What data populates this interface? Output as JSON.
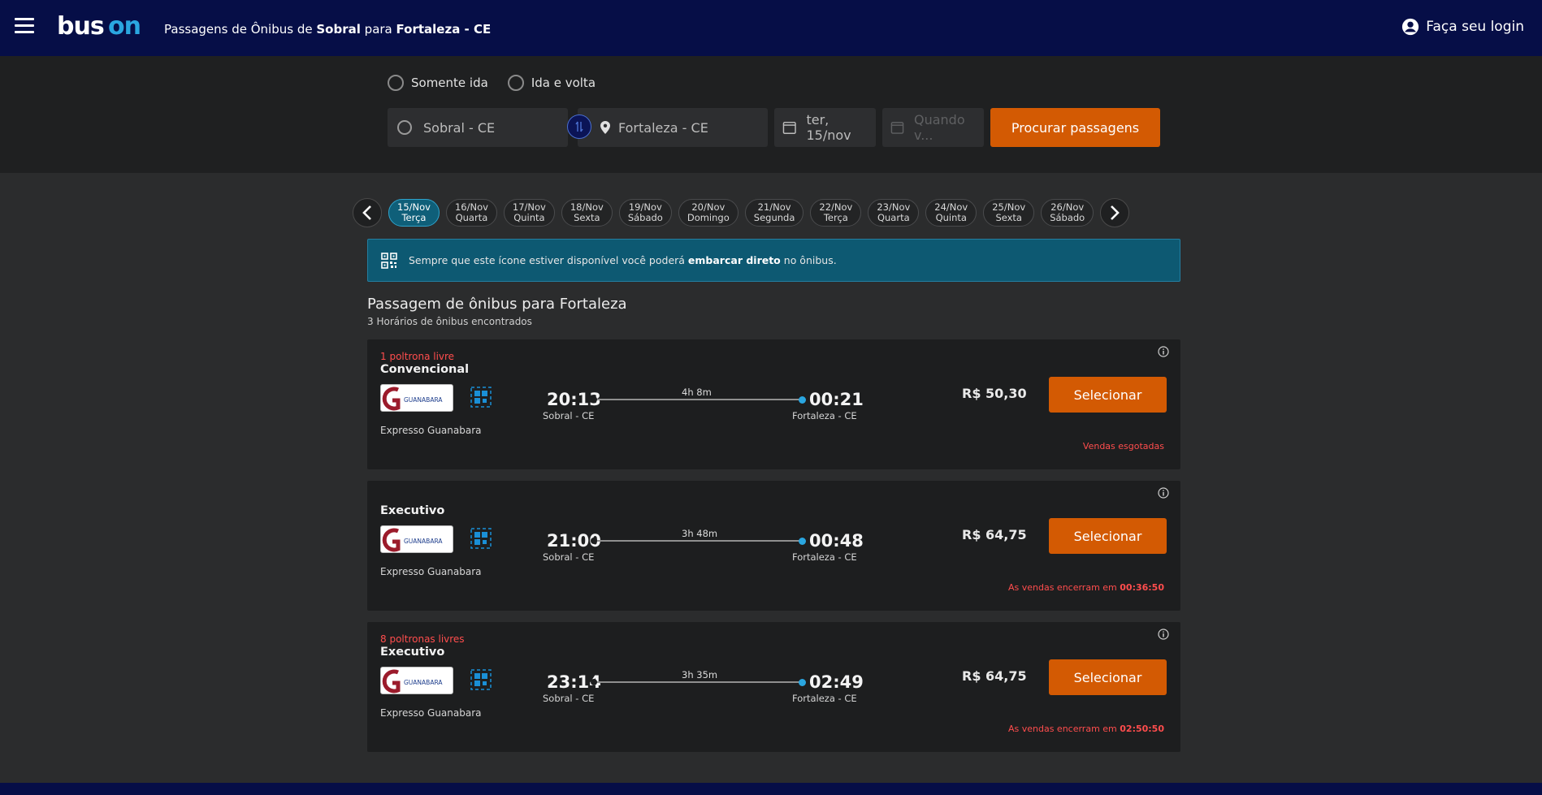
{
  "header": {
    "title_prefix": "Passagens de Ônibus de",
    "origin": "Sobral",
    "title_mid": "para",
    "destination": "Fortaleza - CE",
    "login_label": "Faça seu login",
    "logo_text": "buson"
  },
  "search": {
    "trip_one_way": "Somente ida",
    "trip_round": "Ida e volta",
    "origin_value": "Sobral - CE",
    "destination_value": "Fortaleza - CE",
    "departure_date": "ter, 15/nov",
    "return_placeholder": "Quando v...",
    "search_button": "Procurar passagens"
  },
  "dates": [
    {
      "date": "15/Nov",
      "day": "Terça",
      "active": true
    },
    {
      "date": "16/Nov",
      "day": "Quarta"
    },
    {
      "date": "17/Nov",
      "day": "Quinta"
    },
    {
      "date": "18/Nov",
      "day": "Sexta"
    },
    {
      "date": "19/Nov",
      "day": "Sábado"
    },
    {
      "date": "20/Nov",
      "day": "Domingo"
    },
    {
      "date": "21/Nov",
      "day": "Segunda"
    },
    {
      "date": "22/Nov",
      "day": "Terça"
    },
    {
      "date": "23/Nov",
      "day": "Quarta"
    },
    {
      "date": "24/Nov",
      "day": "Quinta"
    },
    {
      "date": "25/Nov",
      "day": "Sexta"
    },
    {
      "date": "26/Nov",
      "day": "Sábado"
    }
  ],
  "banner": {
    "text_before": "Sempre que este ícone estiver disponível você poderá",
    "text_bold": "embarcar direto",
    "text_after": "no ônibus."
  },
  "results": {
    "title": "Passagem de ônibus para Fortaleza",
    "count": "3 Horários de ônibus encontrados"
  },
  "trips": [
    {
      "seats": "1 poltrona livre",
      "class": "Convencional",
      "company": "Expresso Guanabara",
      "departure": "20:13",
      "arrival": "00:21",
      "duration": "4h 8m",
      "from": "Sobral - CE",
      "to": "Fortaleza - CE",
      "price": "R$ 50,30",
      "select": "Selecionar",
      "note": "Vendas esgotadas",
      "note_time": ""
    },
    {
      "seats": "",
      "class": "Executivo",
      "company": "Expresso Guanabara",
      "departure": "21:00",
      "arrival": "00:48",
      "duration": "3h 48m",
      "from": "Sobral - CE",
      "to": "Fortaleza - CE",
      "price": "R$ 64,75",
      "select": "Selecionar",
      "note": "As vendas encerram em",
      "note_time": "00:36:50"
    },
    {
      "seats": "8 poltronas livres",
      "class": "Executivo",
      "company": "Expresso Guanabara",
      "departure": "23:14",
      "arrival": "02:49",
      "duration": "3h 35m",
      "from": "Sobral - CE",
      "to": "Fortaleza - CE",
      "price": "R$ 64,75",
      "select": "Selecionar",
      "note": "As vendas encerram em",
      "note_time": "02:50:50"
    }
  ],
  "company_logo_text": "GUANABARA",
  "colors": {
    "header_bg": "#060e47",
    "accent_orange": "#d35a03",
    "banner_bg": "#0d5972",
    "alert_red": "#ff4d4d",
    "route_dot": "#2aa6e0"
  }
}
